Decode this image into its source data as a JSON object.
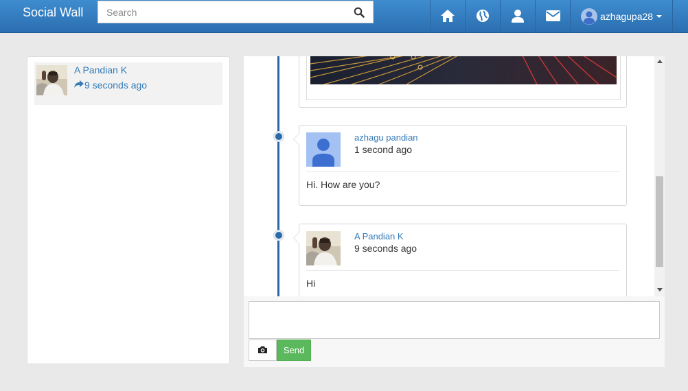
{
  "app": {
    "brand": "Social Wall"
  },
  "search": {
    "placeholder": "Search",
    "icon": "search-icon"
  },
  "nav": {
    "icons": [
      "home-icon",
      "globe-icon",
      "user-icon",
      "envelope-icon"
    ],
    "username": "azhagupa28"
  },
  "contacts": [
    {
      "name": "A Pandian K",
      "time": "9 seconds ago",
      "icon": "share-icon"
    }
  ],
  "posts": [
    {
      "type": "image"
    },
    {
      "author": "azhagu pandian",
      "time": "1 second ago",
      "message": "Hi. How are you?"
    },
    {
      "author": "A Pandian K",
      "time": "9 seconds ago",
      "message": "Hi"
    }
  ],
  "composer": {
    "value": "",
    "camera_icon": "camera-icon",
    "send_label": "Send"
  },
  "colors": {
    "navbar": "#2f78bf",
    "link": "#337ab7",
    "timeline": "#2565a6",
    "send": "#5cb85c"
  }
}
